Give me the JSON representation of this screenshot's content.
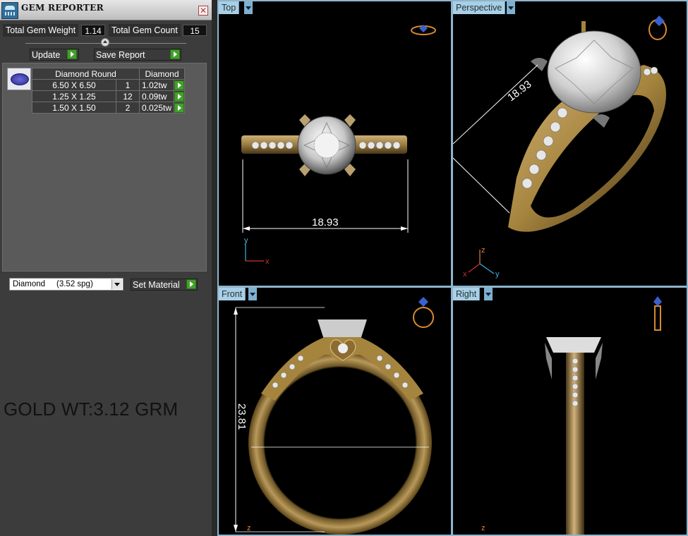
{
  "panel": {
    "title": "GEM REPORTER",
    "close_label": "✕",
    "total_gem_weight_label": "Total Gem Weight",
    "total_gem_weight": "1.14",
    "total_gem_count_label": "Total Gem Count",
    "total_gem_count": "15",
    "update_label": "Update",
    "save_report_label": "Save Report",
    "table": {
      "headers": [
        "Diamond Round",
        "Diamond"
      ],
      "rows": [
        {
          "size": "6.50 X 6.50",
          "count": "1",
          "weight": "1.02tw"
        },
        {
          "size": "1.25 X 1.25",
          "count": "12",
          "weight": "0.09tw"
        },
        {
          "size": "1.50 X 1.50",
          "count": "2",
          "weight": "0.025tw"
        }
      ]
    },
    "material_value": "Diamond     (3.52 spg)",
    "set_material_label": "Set Material",
    "gold_wt": "GOLD WT:3.12 GRM"
  },
  "viewports": {
    "top": {
      "label": "Top",
      "dimension": "18.93",
      "axis_y": "y",
      "axis_x": "x"
    },
    "perspective": {
      "label": "Perspective",
      "dimension": "18.93",
      "axis_z": "z",
      "axis_x": "x",
      "axis_y": "y"
    },
    "front": {
      "label": "Front",
      "dimension": "23.81",
      "axis_z": "z"
    },
    "right": {
      "label": "Right",
      "axis_z": "z"
    }
  },
  "colors": {
    "gold": "#a88a4e",
    "viewport_border": "#8eb5cc",
    "tab_bg": "#a9cfe6",
    "play_green": "#43a02a",
    "axis_x": "#d03030",
    "axis_y": "#40b0e0",
    "axis_z": "#e08040"
  }
}
